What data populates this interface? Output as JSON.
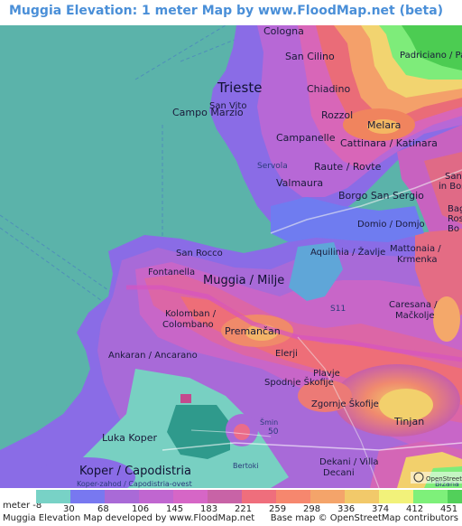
{
  "title": "Muggia Elevation: 1 meter Map by www.FloodMap.net (beta)",
  "map": {
    "labels": {
      "cologna": "Cologna",
      "san_cilino": "San Cilino",
      "padriciano": "Padriciano / Padriče",
      "trieste": "Trieste",
      "campo_marzio": "Campo Marzio",
      "san_vito": "San Vito",
      "chiadino": "Chiadino",
      "rozzol": "Rozzol",
      "melara": "Melara",
      "campanelle": "Campanelle",
      "cattinara": "Cattinara / Katinara",
      "servola": "Servola",
      "raute": "Raute / Rovte",
      "valmaura": "Valmaura",
      "san_bos": "San\nin Bos",
      "borgo_san_sergio": "Borgo San Sergio",
      "domio": "Domio / Domjo",
      "bag": "Bag\nRos\nBo",
      "san_rocco": "San Rocco",
      "aquilinia": "Aquilinia / Žavlje",
      "mattonaia": "Mattonaia /\nKrmenka",
      "fontanella": "Fontanella",
      "muggia": "Muggia / Milje",
      "kolomban": "Kolomban /\nColombano",
      "premancan": "Premančan",
      "caresana": "Caresana /\nMačkolje",
      "ankaran": "Ankaran / Ancarano",
      "elerji": "Elerji",
      "plavje": "Plavje",
      "spodnje": "Spodnje Škofije",
      "zgornje": "Zgornje Škofije",
      "tinjan": "Tinjan",
      "luka_koper": "Luka Koper",
      "smin": "Šmin",
      "road_50": "50",
      "road_s11": "S11",
      "bertoki": "Bertoki",
      "dekani": "Dekani / Villa\nDecani",
      "koper": "Koper / Capodistria",
      "koper_zahod": "Koper-zahod / Capodistria-ovest",
      "bizana": "Bižana",
      "osm_badge": "OpenStreetMap"
    }
  },
  "legend": {
    "unit_label": "meter",
    "min_label": "-8",
    "thresholds": [
      "30",
      "68",
      "106",
      "145",
      "183",
      "221",
      "259",
      "298",
      "336",
      "374",
      "412",
      "451"
    ],
    "colors": [
      "#78d2c6",
      "#7878f0",
      "#a96ad7",
      "#c066d0",
      "#d666c6",
      "#c863a6",
      "#ef6e7c",
      "#f6876e",
      "#f4a46a",
      "#f2c96a",
      "#f2f27a",
      "#7ef07a",
      "#52d05a"
    ]
  },
  "footer": {
    "left": "Muggia Elevation Map developed by www.FloodMap.net",
    "right": "Base map © OpenStreetMap contributors"
  }
}
